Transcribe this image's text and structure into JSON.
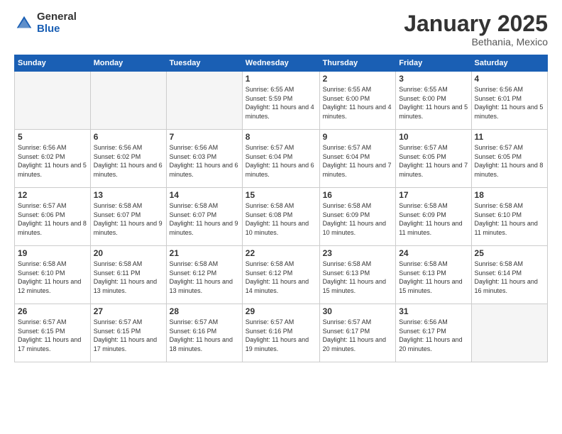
{
  "header": {
    "logo_general": "General",
    "logo_blue": "Blue",
    "month": "January 2025",
    "location": "Bethania, Mexico"
  },
  "weekdays": [
    "Sunday",
    "Monday",
    "Tuesday",
    "Wednesday",
    "Thursday",
    "Friday",
    "Saturday"
  ],
  "weeks": [
    [
      {
        "day": "",
        "empty": true
      },
      {
        "day": "",
        "empty": true
      },
      {
        "day": "",
        "empty": true
      },
      {
        "day": "1",
        "sunrise": "6:55 AM",
        "sunset": "5:59 PM",
        "daylight": "11 hours and 4 minutes."
      },
      {
        "day": "2",
        "sunrise": "6:55 AM",
        "sunset": "6:00 PM",
        "daylight": "11 hours and 4 minutes."
      },
      {
        "day": "3",
        "sunrise": "6:55 AM",
        "sunset": "6:00 PM",
        "daylight": "11 hours and 5 minutes."
      },
      {
        "day": "4",
        "sunrise": "6:56 AM",
        "sunset": "6:01 PM",
        "daylight": "11 hours and 5 minutes."
      }
    ],
    [
      {
        "day": "5",
        "sunrise": "6:56 AM",
        "sunset": "6:02 PM",
        "daylight": "11 hours and 5 minutes."
      },
      {
        "day": "6",
        "sunrise": "6:56 AM",
        "sunset": "6:02 PM",
        "daylight": "11 hours and 6 minutes."
      },
      {
        "day": "7",
        "sunrise": "6:56 AM",
        "sunset": "6:03 PM",
        "daylight": "11 hours and 6 minutes."
      },
      {
        "day": "8",
        "sunrise": "6:57 AM",
        "sunset": "6:04 PM",
        "daylight": "11 hours and 6 minutes."
      },
      {
        "day": "9",
        "sunrise": "6:57 AM",
        "sunset": "6:04 PM",
        "daylight": "11 hours and 7 minutes."
      },
      {
        "day": "10",
        "sunrise": "6:57 AM",
        "sunset": "6:05 PM",
        "daylight": "11 hours and 7 minutes."
      },
      {
        "day": "11",
        "sunrise": "6:57 AM",
        "sunset": "6:05 PM",
        "daylight": "11 hours and 8 minutes."
      }
    ],
    [
      {
        "day": "12",
        "sunrise": "6:57 AM",
        "sunset": "6:06 PM",
        "daylight": "11 hours and 8 minutes."
      },
      {
        "day": "13",
        "sunrise": "6:58 AM",
        "sunset": "6:07 PM",
        "daylight": "11 hours and 9 minutes."
      },
      {
        "day": "14",
        "sunrise": "6:58 AM",
        "sunset": "6:07 PM",
        "daylight": "11 hours and 9 minutes."
      },
      {
        "day": "15",
        "sunrise": "6:58 AM",
        "sunset": "6:08 PM",
        "daylight": "11 hours and 10 minutes."
      },
      {
        "day": "16",
        "sunrise": "6:58 AM",
        "sunset": "6:09 PM",
        "daylight": "11 hours and 10 minutes."
      },
      {
        "day": "17",
        "sunrise": "6:58 AM",
        "sunset": "6:09 PM",
        "daylight": "11 hours and 11 minutes."
      },
      {
        "day": "18",
        "sunrise": "6:58 AM",
        "sunset": "6:10 PM",
        "daylight": "11 hours and 11 minutes."
      }
    ],
    [
      {
        "day": "19",
        "sunrise": "6:58 AM",
        "sunset": "6:10 PM",
        "daylight": "11 hours and 12 minutes."
      },
      {
        "day": "20",
        "sunrise": "6:58 AM",
        "sunset": "6:11 PM",
        "daylight": "11 hours and 13 minutes."
      },
      {
        "day": "21",
        "sunrise": "6:58 AM",
        "sunset": "6:12 PM",
        "daylight": "11 hours and 13 minutes."
      },
      {
        "day": "22",
        "sunrise": "6:58 AM",
        "sunset": "6:12 PM",
        "daylight": "11 hours and 14 minutes."
      },
      {
        "day": "23",
        "sunrise": "6:58 AM",
        "sunset": "6:13 PM",
        "daylight": "11 hours and 15 minutes."
      },
      {
        "day": "24",
        "sunrise": "6:58 AM",
        "sunset": "6:13 PM",
        "daylight": "11 hours and 15 minutes."
      },
      {
        "day": "25",
        "sunrise": "6:58 AM",
        "sunset": "6:14 PM",
        "daylight": "11 hours and 16 minutes."
      }
    ],
    [
      {
        "day": "26",
        "sunrise": "6:57 AM",
        "sunset": "6:15 PM",
        "daylight": "11 hours and 17 minutes."
      },
      {
        "day": "27",
        "sunrise": "6:57 AM",
        "sunset": "6:15 PM",
        "daylight": "11 hours and 17 minutes."
      },
      {
        "day": "28",
        "sunrise": "6:57 AM",
        "sunset": "6:16 PM",
        "daylight": "11 hours and 18 minutes."
      },
      {
        "day": "29",
        "sunrise": "6:57 AM",
        "sunset": "6:16 PM",
        "daylight": "11 hours and 19 minutes."
      },
      {
        "day": "30",
        "sunrise": "6:57 AM",
        "sunset": "6:17 PM",
        "daylight": "11 hours and 20 minutes."
      },
      {
        "day": "31",
        "sunrise": "6:56 AM",
        "sunset": "6:17 PM",
        "daylight": "11 hours and 20 minutes."
      },
      {
        "day": "",
        "empty": true
      }
    ]
  ]
}
